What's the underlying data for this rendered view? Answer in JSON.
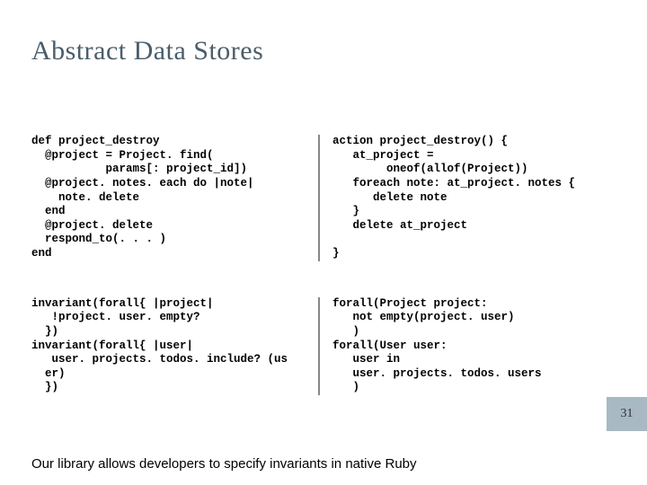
{
  "title": "Abstract Data Stores",
  "code": {
    "topLeft": "def project_destroy\n  @project = Project. find(\n           params[: project_id])\n  @project. notes. each do |note|\n    note. delete\n  end\n  @project. delete\n  respond_to(. . . )\nend",
    "topRight": "action project_destroy() {\n   at_project =\n        oneof(allof(Project))\n   foreach note: at_project. notes {\n      delete note\n   }\n   delete at_project\n\n}",
    "bottomLeft": "invariant(forall{ |project|\n   !project. user. empty?\n  })\ninvariant(forall{ |user|\n   user. projects. todos. include? (us\n  er)\n  })",
    "bottomRight": "forall(Project project:\n   not empty(project. user)\n   )\nforall(User user:\n   user in\n   user. projects. todos. users\n   )"
  },
  "caption": "Our library allows developers to specify invariants in native Ruby",
  "pageNumber": "31"
}
